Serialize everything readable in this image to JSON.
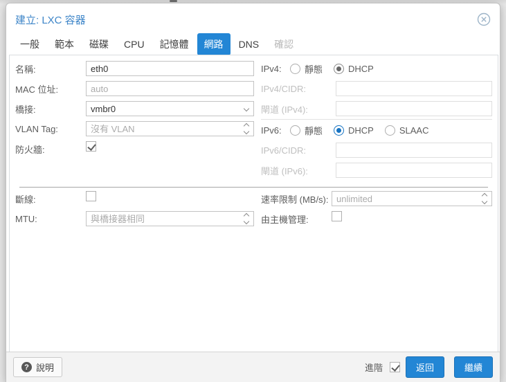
{
  "window": {
    "title": "建立: LXC 容器"
  },
  "tabs": [
    {
      "label": "一般"
    },
    {
      "label": "範本"
    },
    {
      "label": "磁碟"
    },
    {
      "label": "CPU"
    },
    {
      "label": "記憶體"
    },
    {
      "label": "網路"
    },
    {
      "label": "DNS"
    },
    {
      "label": "確認"
    }
  ],
  "form": {
    "name": {
      "label": "名稱:",
      "value": "eth0"
    },
    "mac": {
      "label": "MAC 位址:",
      "placeholder": "auto"
    },
    "bridge": {
      "label": "橋接:",
      "value": "vmbr0"
    },
    "vlan": {
      "label": "VLAN Tag:",
      "placeholder": "沒有 VLAN"
    },
    "firewall": {
      "label": "防火牆:",
      "checked": true
    },
    "ipv4": {
      "label": "IPv4:",
      "static_label": "靜態",
      "dhcp_label": "DHCP",
      "selected": "DHCP"
    },
    "ipv4_cidr": {
      "label": "IPv4/CIDR:",
      "value": ""
    },
    "ipv4_gateway": {
      "label": "閘道 (IPv4):",
      "value": ""
    },
    "ipv6": {
      "label": "IPv6:",
      "static_label": "靜態",
      "dhcp_label": "DHCP",
      "slaac_label": "SLAAC",
      "selected": "DHCP"
    },
    "ipv6_cidr": {
      "label": "IPv6/CIDR:",
      "value": ""
    },
    "ipv6_gateway": {
      "label": "閘道 (IPv6):",
      "value": ""
    },
    "disconnect": {
      "label": "斷線:",
      "checked": false
    },
    "mtu": {
      "label": "MTU:",
      "placeholder": "與橋接器相同"
    },
    "rate_limit": {
      "label": "速率限制 (MB/s):",
      "placeholder": "unlimited"
    },
    "host_managed": {
      "label": "由主機管理:",
      "checked": false
    }
  },
  "footer": {
    "help": "說明",
    "help_icon": "?",
    "advanced": "進階",
    "advanced_checked": true,
    "back": "返回",
    "next": "繼續"
  },
  "colors": {
    "accent": "#2386d5",
    "title_blue": "#3d85c8",
    "radio_selected_blue": "#1673c2",
    "radio_selected_gray": "#666666",
    "footer_bg": "#f3f3f3"
  }
}
